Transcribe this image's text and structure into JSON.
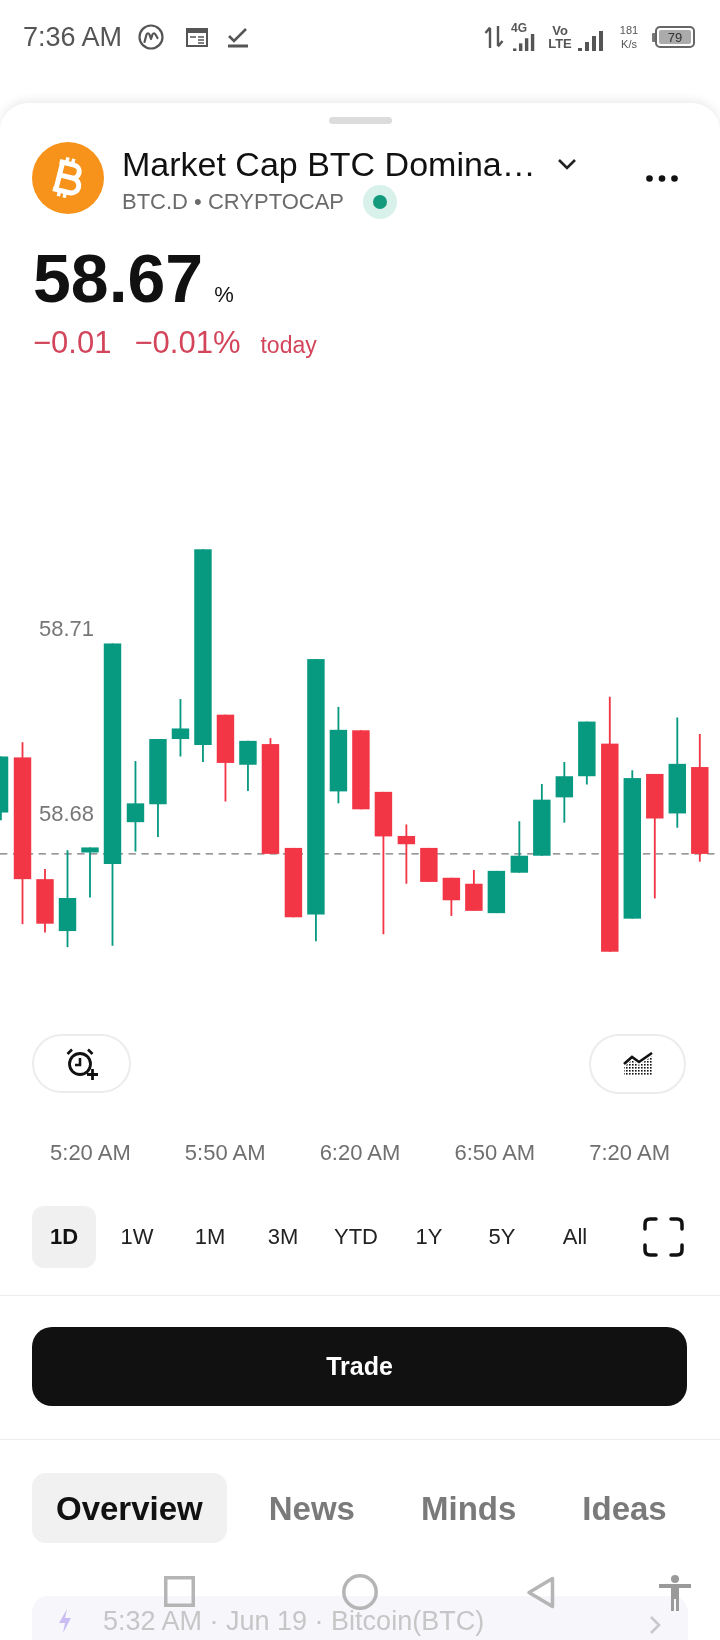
{
  "status_bar": {
    "time": "7:36 AM",
    "network": "4G",
    "volte": "Vo LTE",
    "speed": "181 K/s",
    "battery": "79"
  },
  "header": {
    "title": "Market Cap BTC Domina…",
    "subtitle": "BTC.D • CRYPTOCAP",
    "market_open": true
  },
  "quote": {
    "price": "58.67",
    "unit": "%",
    "change": "−0.01",
    "change_percent": "−0.01%",
    "period": "today",
    "negative": true
  },
  "chart": {
    "y_labels": [
      "58.71",
      "58.68"
    ],
    "x_labels": [
      "5:20 AM",
      "5:50 AM",
      "6:20 AM",
      "6:50 AM",
      "7:20 AM"
    ]
  },
  "ranges": [
    {
      "label": "1D",
      "selected": true
    },
    {
      "label": "1W",
      "selected": false
    },
    {
      "label": "1M",
      "selected": false
    },
    {
      "label": "3M",
      "selected": false
    },
    {
      "label": "YTD",
      "selected": false
    },
    {
      "label": "1Y",
      "selected": false
    },
    {
      "label": "5Y",
      "selected": false
    },
    {
      "label": "All",
      "selected": false
    }
  ],
  "trade_button": {
    "label": "Trade"
  },
  "tabs": [
    {
      "label": "Overview",
      "selected": true
    },
    {
      "label": "News",
      "selected": false
    },
    {
      "label": "Minds",
      "selected": false
    },
    {
      "label": "Ideas",
      "selected": false
    }
  ],
  "news_item": {
    "text": "5:32 AM · Jun 19 · Bitcoin(BTC)"
  }
}
